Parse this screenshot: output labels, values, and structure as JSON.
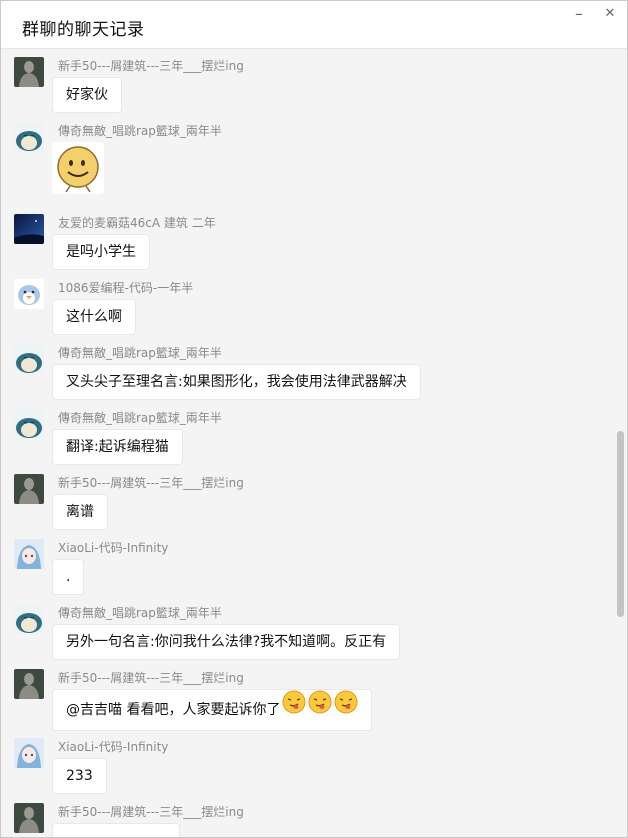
{
  "window": {
    "title": "群聊的聊天记录",
    "minimize_glyph": "–",
    "close_glyph": "✕"
  },
  "messages": [
    {
      "sender": "新手50---屑建筑---三年___摆烂ing",
      "text": "好家伙",
      "avatar": "statue-avatar"
    },
    {
      "sender": "傳奇無敵_唱跳rap籃球_兩年半",
      "text": "",
      "avatar": "snorlax-avatar",
      "sticker": "smiley-face-sticker"
    },
    {
      "sender": "友爱的麦霸菇46cA   建筑 二年",
      "text": "是吗小学生",
      "avatar": "night-sky-avatar"
    },
    {
      "sender": "1086爱编程-代码-一年半",
      "text": "这什么啊",
      "avatar": "penguin-avatar"
    },
    {
      "sender": "傳奇無敵_唱跳rap籃球_兩年半",
      "text": "叉头尖子至理名言:如果图形化，我会使用法律武器解决",
      "avatar": "snorlax-avatar"
    },
    {
      "sender": "傳奇無敵_唱跳rap籃球_兩年半",
      "text": "翻译:起诉编程猫",
      "avatar": "snorlax-avatar"
    },
    {
      "sender": "新手50---屑建筑---三年___摆烂ing",
      "text": "离谱",
      "avatar": "statue-avatar"
    },
    {
      "sender": "XiaoLi-代码-Infinity",
      "text": ".",
      "avatar": "anime-avatar"
    },
    {
      "sender": "傳奇無敵_唱跳rap籃球_兩年半",
      "text": "另外一句名言:你问我什么法律?我不知道啊。反正有",
      "avatar": "snorlax-avatar"
    },
    {
      "sender": "新手50---屑建筑---三年___摆烂ing",
      "text": "@吉吉喵 看看吧，人家要起诉你了",
      "avatar": "statue-avatar",
      "emojis": [
        "tongue-out-emoji",
        "tongue-out-emoji",
        "tongue-out-emoji"
      ]
    },
    {
      "sender": "XiaoLi-代码-Infinity",
      "text": "233",
      "avatar": "anime-avatar"
    },
    {
      "sender": "新手50---屑建筑---三年___摆烂ing",
      "text": "",
      "avatar": "statue-avatar"
    }
  ],
  "colors": {
    "background": "#f4f4f4",
    "bubble": "#ffffff",
    "sender_text": "#8a8a8a",
    "scrollbar_thumb": "#c3c3c3"
  }
}
